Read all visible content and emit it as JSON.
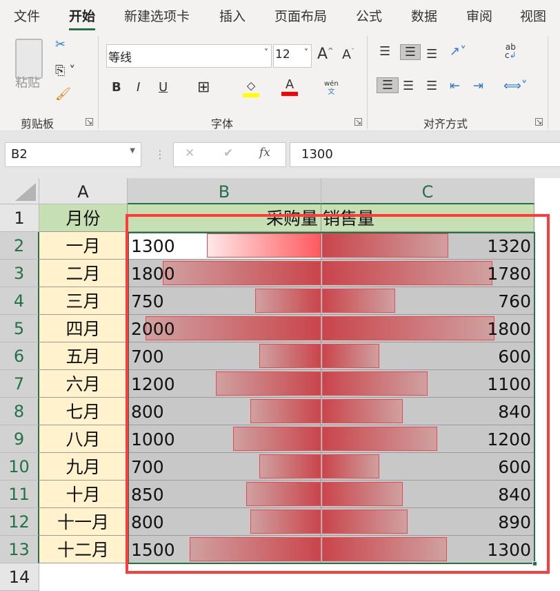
{
  "ribbon_tabs": [
    "文件",
    "开始",
    "新建选项卡",
    "插入",
    "页面布局",
    "公式",
    "数据",
    "审阅",
    "视图"
  ],
  "active_tab": "开始",
  "clipboard": {
    "paste": "粘贴",
    "group": "剪贴板"
  },
  "font": {
    "name": "等线",
    "size": "12",
    "group": "字体",
    "phonetic_top": "wén",
    "phonetic_bottom": "文",
    "bold": "B",
    "italic": "I",
    "underline": "U",
    "grow": "A",
    "shrink": "A",
    "color_letter": "A"
  },
  "alignment": {
    "group": "对齐方式",
    "wrap_top": "ab",
    "wrap_bottom": "c"
  },
  "formula_bar": {
    "name_box": "B2",
    "fx": "fx",
    "value": "1300"
  },
  "colors": {
    "accent": "#217346",
    "header_fill": "#c6e0b4",
    "month_fill": "#fff2cc",
    "bar_red": "#c0392b",
    "highlight": "#ff3b3b",
    "selection": "#c8c8c8"
  },
  "columns": [
    "A",
    "B",
    "C"
  ],
  "headers": {
    "month": "月份",
    "purchase": "采购量",
    "sales": "销售量"
  },
  "rows": [
    {
      "n": "2",
      "month": "一月",
      "purchase": 1300,
      "sales": 1320
    },
    {
      "n": "3",
      "month": "二月",
      "purchase": 1800,
      "sales": 1780
    },
    {
      "n": "4",
      "month": "三月",
      "purchase": 750,
      "sales": 760
    },
    {
      "n": "5",
      "month": "四月",
      "purchase": 2000,
      "sales": 1800
    },
    {
      "n": "6",
      "month": "五月",
      "purchase": 700,
      "sales": 600
    },
    {
      "n": "7",
      "month": "六月",
      "purchase": 1200,
      "sales": 1100
    },
    {
      "n": "8",
      "month": "七月",
      "purchase": 800,
      "sales": 840
    },
    {
      "n": "9",
      "month": "八月",
      "purchase": 1000,
      "sales": 1200
    },
    {
      "n": "10",
      "month": "九月",
      "purchase": 700,
      "sales": 600
    },
    {
      "n": "11",
      "month": "十月",
      "purchase": 850,
      "sales": 840
    },
    {
      "n": "12",
      "month": "十一月",
      "purchase": 800,
      "sales": 890
    },
    {
      "n": "13",
      "month": "十二月",
      "purchase": 1500,
      "sales": 1300
    }
  ],
  "row_numbers": [
    "1",
    "14"
  ]
}
